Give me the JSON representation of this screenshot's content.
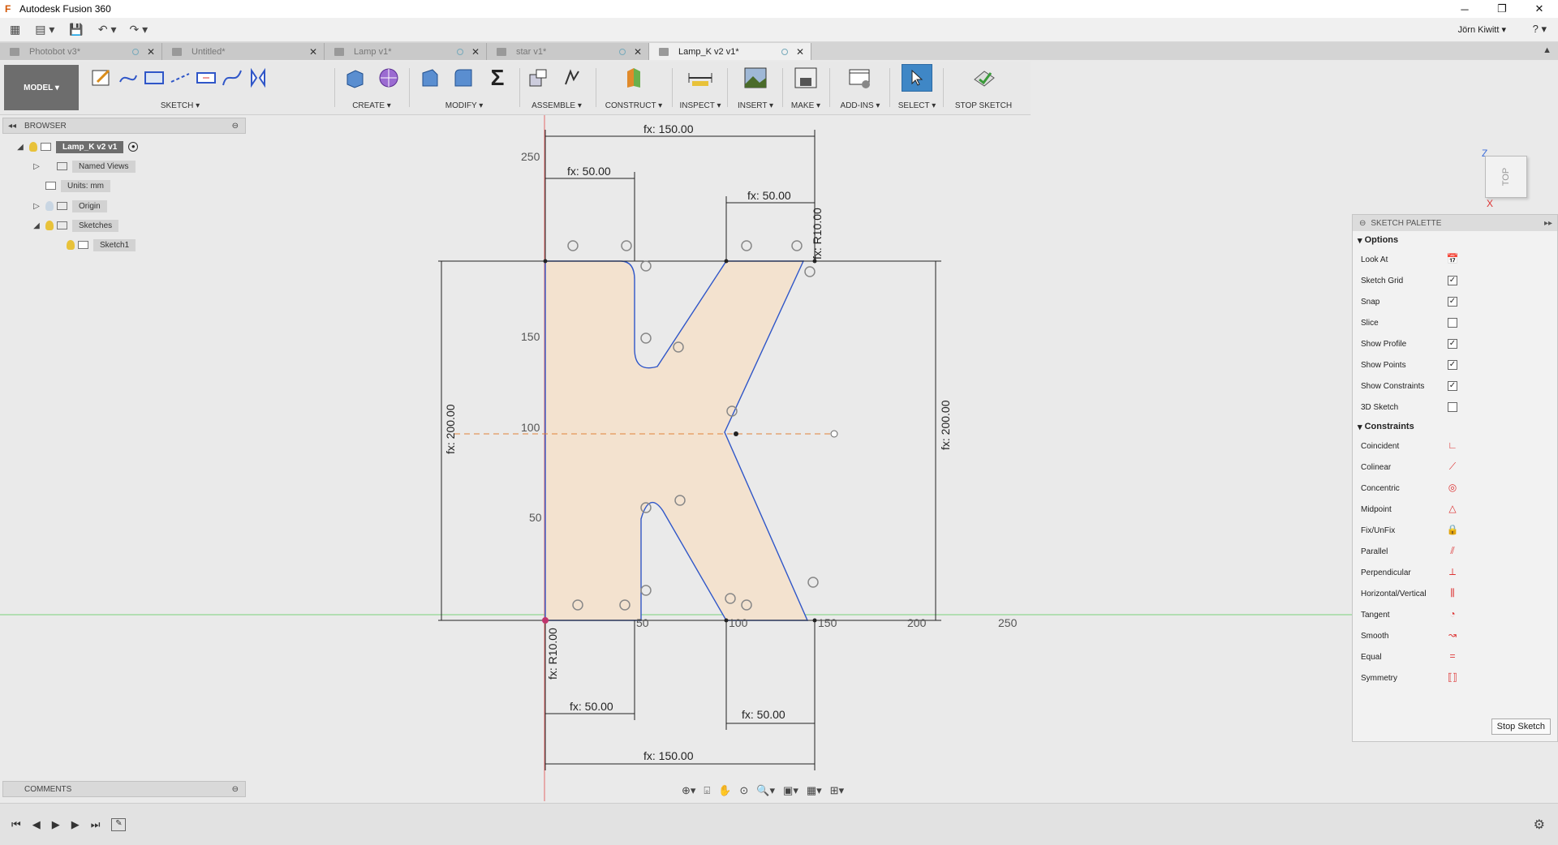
{
  "window": {
    "title": "Autodesk Fusion 360",
    "minimize": "─",
    "restore": "❐",
    "close": "✕"
  },
  "quick_access": {
    "grid": "▦",
    "file": "▤ ▾",
    "save": "💾",
    "undo": "↶ ▾",
    "redo": "↷ ▾",
    "user": "Jörn Kiwitt ▾",
    "help": "? ▾"
  },
  "tabs": [
    {
      "label": "Photobot v3*"
    },
    {
      "label": "Untitled*"
    },
    {
      "label": "Lamp v1*"
    },
    {
      "label": "star v1*"
    },
    {
      "label": "Lamp_K v2 v1*"
    }
  ],
  "toolbar": {
    "workspace": "MODEL ▾",
    "groups": {
      "sketch": "SKETCH ▾",
      "create": "CREATE ▾",
      "modify": "MODIFY ▾",
      "assemble": "ASSEMBLE ▾",
      "construct": "CONSTRUCT ▾",
      "inspect": "INSPECT ▾",
      "insert": "INSERT ▾",
      "make": "MAKE ▾",
      "addins": "ADD-INS ▾",
      "select": "SELECT ▾",
      "stop_sketch": "STOP SKETCH"
    }
  },
  "browser": {
    "header": "BROWSER",
    "root": "Lamp_K v2 v1",
    "items": [
      "Named Views",
      "Units: mm",
      "Origin",
      "Sketches",
      "Sketch1"
    ]
  },
  "sketch": {
    "dims": {
      "top_width": "fx: 150.00",
      "top_left": "fx: 50.00",
      "top_right": "fx: 50.00",
      "bottom_left": "fx: 50.00",
      "bottom_right": "fx: 50.00",
      "bottom_width": "fx: 150.00",
      "left_height": "fx: 200.00",
      "right_height": "fx: 200.00",
      "radius_top": "fx: R10.00",
      "radius_bottom": "fx: R10.00"
    },
    "grid_labels": {
      "y250": "250",
      "y150": "150",
      "y100": "100",
      "y50": "50",
      "x50": "50",
      "x100": "100",
      "x150": "150",
      "x200": "200",
      "x250": "250"
    }
  },
  "viewcube": {
    "face": "TOP",
    "axis_z": "Z",
    "axis_x": "X"
  },
  "palette": {
    "header": "SKETCH PALETTE",
    "options_title": "Options",
    "options": [
      {
        "label": "Look At",
        "checked": null
      },
      {
        "label": "Sketch Grid",
        "checked": true
      },
      {
        "label": "Snap",
        "checked": true
      },
      {
        "label": "Slice",
        "checked": false
      },
      {
        "label": "Show Profile",
        "checked": true
      },
      {
        "label": "Show Points",
        "checked": true
      },
      {
        "label": "Show Constraints",
        "checked": true
      },
      {
        "label": "3D Sketch",
        "checked": false
      }
    ],
    "constraints_title": "Constraints",
    "constraints": [
      {
        "label": "Coincident",
        "icon": "coincident-icon"
      },
      {
        "label": "Colinear",
        "icon": "colinear-icon"
      },
      {
        "label": "Concentric",
        "icon": "concentric-icon"
      },
      {
        "label": "Midpoint",
        "icon": "midpoint-icon"
      },
      {
        "label": "Fix/UnFix",
        "icon": "lock-icon"
      },
      {
        "label": "Parallel",
        "icon": "parallel-icon"
      },
      {
        "label": "Perpendicular",
        "icon": "perpendicular-icon"
      },
      {
        "label": "Horizontal/Vertical",
        "icon": "horizontal-vertical-icon"
      },
      {
        "label": "Tangent",
        "icon": "tangent-icon"
      },
      {
        "label": "Smooth",
        "icon": "smooth-icon"
      },
      {
        "label": "Equal",
        "icon": "equal-icon"
      },
      {
        "label": "Symmetry",
        "icon": "symmetry-icon"
      }
    ],
    "stop_button": "Stop Sketch"
  },
  "comments": {
    "header": "COMMENTS"
  },
  "colors": {
    "profile_fill": "#f3e2cf",
    "sketch_line": "#2f56c8",
    "accent": "#3f87c6",
    "axis_green": "#66cc66",
    "axis_red": "#e05050"
  }
}
